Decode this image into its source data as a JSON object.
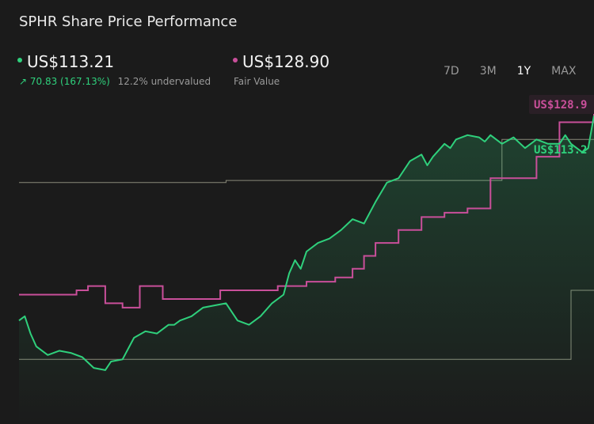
{
  "header": {
    "title": "SPHR Share Price Performance"
  },
  "price": {
    "value": "US$113.21",
    "change": "70.83 (167.13%)",
    "valuation": "12.2% undervalued",
    "color": "#2fd07c"
  },
  "fair_value": {
    "value": "US$128.90",
    "label": "Fair Value",
    "color": "#c94f9a"
  },
  "timeframes": [
    "7D",
    "3M",
    "1Y",
    "MAX"
  ],
  "active_timeframe": "1Y",
  "badges": {
    "fair_value": "US$128.9",
    "price": "US$113.2"
  },
  "chart_data": {
    "type": "line",
    "y_range": [
      0,
      160
    ],
    "series": [
      {
        "name": "Share Price",
        "color": "#2fd07c",
        "x": [
          0,
          0.01,
          0.02,
          0.03,
          0.05,
          0.07,
          0.09,
          0.11,
          0.13,
          0.15,
          0.16,
          0.18,
          0.2,
          0.22,
          0.24,
          0.25,
          0.26,
          0.27,
          0.28,
          0.3,
          0.32,
          0.34,
          0.36,
          0.38,
          0.4,
          0.42,
          0.44,
          0.46,
          0.47,
          0.48,
          0.49,
          0.5,
          0.52,
          0.54,
          0.56,
          0.58,
          0.6,
          0.62,
          0.64,
          0.66,
          0.68,
          0.7,
          0.71,
          0.72,
          0.74,
          0.75,
          0.76,
          0.78,
          0.8,
          0.81,
          0.82,
          0.84,
          0.86,
          0.88,
          0.9,
          0.92,
          0.94,
          0.95,
          0.96,
          0.98,
          0.99,
          1.0
        ],
        "y": [
          48,
          50,
          42,
          36,
          32,
          34,
          33,
          31,
          26,
          25,
          29,
          30,
          40,
          43,
          42,
          44,
          46,
          46,
          48,
          50,
          54,
          55,
          56,
          48,
          46,
          50,
          56,
          60,
          70,
          76,
          72,
          80,
          84,
          86,
          90,
          95,
          93,
          103,
          112,
          114,
          122,
          125,
          120,
          124,
          130,
          128,
          132,
          134,
          133,
          131,
          134,
          130,
          133,
          128,
          132,
          130,
          130,
          134,
          130,
          126,
          128,
          143
        ]
      },
      {
        "name": "Fair Value",
        "color": "#c94f9a",
        "x": [
          0,
          0.08,
          0.1,
          0.12,
          0.15,
          0.18,
          0.21,
          0.25,
          0.3,
          0.35,
          0.4,
          0.45,
          0.5,
          0.55,
          0.58,
          0.6,
          0.62,
          0.66,
          0.7,
          0.74,
          0.78,
          0.82,
          0.86,
          0.9,
          0.94,
          0.97,
          1.0
        ],
        "y": [
          60,
          60,
          62,
          64,
          56,
          54,
          64,
          58,
          58,
          62,
          62,
          64,
          66,
          68,
          72,
          78,
          84,
          90,
          96,
          98,
          100,
          114,
          114,
          124,
          140,
          140,
          152
        ]
      }
    ],
    "reference_lines": [
      {
        "color": "#8a8a7a",
        "x": [
          0,
          0.35,
          0.36,
          0.83,
          0.84,
          0.96,
          0.97,
          1.0
        ],
        "y": [
          112,
          112,
          113,
          113,
          132,
          132,
          132,
          132
        ]
      },
      {
        "color": "#8a8a7a",
        "x": [
          0,
          0.96,
          0.96,
          1.0
        ],
        "y": [
          30,
          30,
          62,
          62
        ]
      }
    ]
  }
}
